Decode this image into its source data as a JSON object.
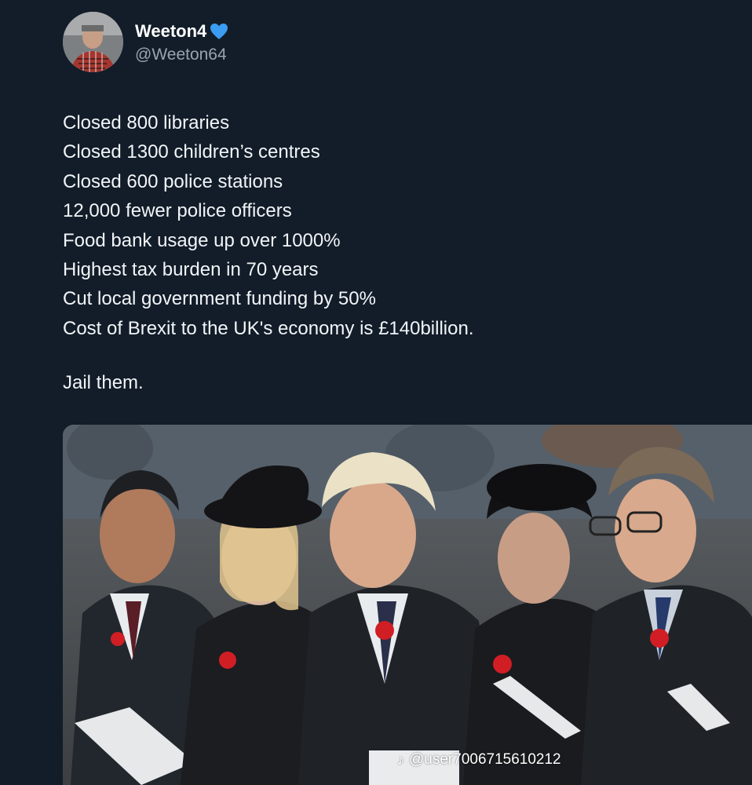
{
  "tweet": {
    "display_name": "Weeton4",
    "verified_icon": "blue-heart-icon",
    "handle": "@Weeton64",
    "lines": [
      "Closed 800 libraries",
      "Closed 1300 children’s centres",
      "Closed 600 police stations",
      "12,000 fewer police officers",
      "Food bank usage up over 1000%",
      "Highest tax burden in 70 years",
      "Cut local government funding by 50%",
      "Cost of Brexit to the UK's economy is £140billion."
    ],
    "closing": "Jail them."
  },
  "media": {
    "watermark_icon": "tiktok-icon",
    "watermark_text": "@user7006715610212"
  },
  "colors": {
    "background": "#121d29",
    "text": "#f2f5f8",
    "muted": "#9aa4ae",
    "heart": "#3b9cf2",
    "poppy": "#d01e24"
  }
}
